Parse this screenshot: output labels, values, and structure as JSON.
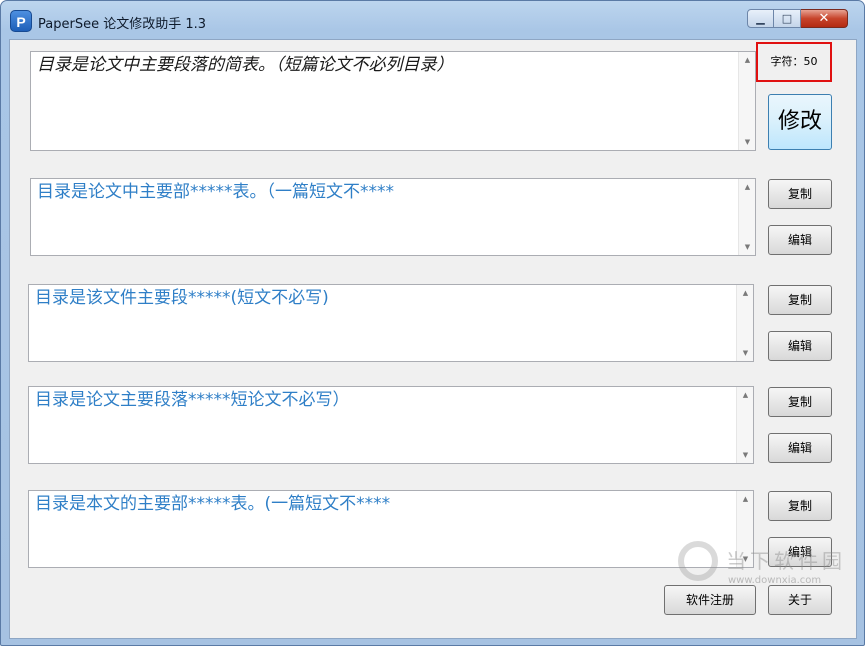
{
  "window": {
    "title": "PaperSee 论文修改助手 1.3",
    "icon_letter": "P",
    "min_glyph": "▁",
    "max_glyph": "□",
    "close_glyph": "✕"
  },
  "source": {
    "text": "目录是论文中主要段落的简表。（短篇论文不必列目录）"
  },
  "char_count": "字符：50",
  "modify_label": "修改",
  "results": [
    {
      "text": "目录是论文中主要部*****表。（一篇短文不****",
      "copy_label": "复制",
      "edit_label": "编辑"
    },
    {
      "text": "目录是该文件主要段*****(短文不必写)",
      "copy_label": "复制",
      "edit_label": "编辑"
    },
    {
      "text": "目录是论文主要段落*****短论文不必写）",
      "copy_label": "复制",
      "edit_label": "编辑"
    },
    {
      "text": "目录是本文的主要部*****表。(一篇短文不****",
      "copy_label": "复制",
      "edit_label": "编辑"
    }
  ],
  "footer": {
    "register_label": "软件注册",
    "about_label": "关于"
  },
  "watermark": {
    "text": "当下软件园",
    "url": "www.downxia.com"
  },
  "scroll_up_glyph": "▲",
  "scroll_down_glyph": "▼",
  "colors": {
    "result_text": "#2f7fc7",
    "highlight_border": "#e01010"
  }
}
